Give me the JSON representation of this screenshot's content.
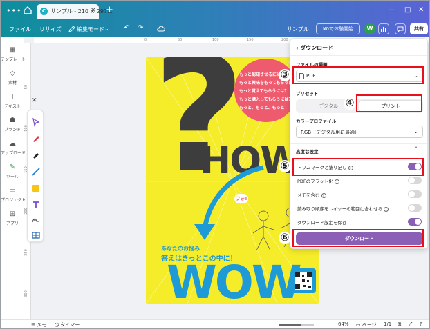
{
  "titlebar": {
    "dots": "•••",
    "tab_title": "サンプル - 210 × 297…",
    "tab_close": "×",
    "new_tab": "+",
    "win_min": "—",
    "win_max": "□",
    "win_close": "✕"
  },
  "toolbar": {
    "file": "ファイル",
    "resize": "リサイズ",
    "edit_mode": "編集モード",
    "doc_name": "サンプル",
    "trial": "¥0で体験開始",
    "avatar": "W",
    "share": "共有"
  },
  "sidebar": {
    "items": [
      {
        "label": "テンプレート",
        "icon": "▦"
      },
      {
        "label": "素材",
        "icon": "◇"
      },
      {
        "label": "テキスト",
        "icon": "T"
      },
      {
        "label": "ブランド",
        "icon": "☗"
      },
      {
        "label": "アップロード",
        "icon": "☁"
      },
      {
        "label": "ツール",
        "icon": "✎"
      },
      {
        "label": "プロジェクト",
        "icon": "▭"
      },
      {
        "label": "アプリ",
        "icon": "⊞"
      }
    ]
  },
  "rulers": {
    "top": [
      "0",
      "50",
      "100",
      "150",
      "200"
    ],
    "left": [
      "50",
      "100",
      "150",
      "200",
      "250",
      "300"
    ]
  },
  "poster": {
    "pink_lines": [
      "もっと認知させるには？",
      "もっと興味をもってもらうには？",
      "もっと覚えてもらうには？",
      "もっと購入してもらうには？",
      "もっと、もっと、もっと"
    ],
    "how": "HOW",
    "wow": "WOW",
    "wao": "ワォ!",
    "tagline1": "あなたのお悩み",
    "tagline2": "答えはきっとこの中に！"
  },
  "download": {
    "header": "ダウンロード",
    "file_type_label": "ファイルの種類",
    "file_type_value": "PDF",
    "preset_label": "プリセット",
    "preset_digital": "デジタル",
    "preset_print": "プリント",
    "color_profile_label": "カラープロファイル",
    "color_profile_value": "RGB（デジタル用に最適）",
    "advanced_label": "高度な設定",
    "options": [
      {
        "label": "トリムマークと塗り足し",
        "on": true
      },
      {
        "label": "PDFのフラット化",
        "on": false
      },
      {
        "label": "メモを含む",
        "on": false
      },
      {
        "label": "読み取り順序をレイヤーの範囲に合わせる",
        "on": false
      },
      {
        "label": "ダウンロード設定を保存",
        "on": true
      }
    ],
    "button": "ダウンロード"
  },
  "annotations": {
    "n3": "③",
    "n4": "④",
    "n5": "⑤",
    "n6": "⑥"
  },
  "statusbar": {
    "memo": "メモ",
    "timer": "タイマー",
    "zoom": "64%",
    "zoom_fraction": 0.64,
    "pages": "ページ",
    "page_num": "1/1"
  },
  "colors": {
    "accent_purple": "#8a5fb5",
    "annotation_red": "#e8101b",
    "poster_yellow": "#f5ec2a",
    "poster_blue": "#1e9ad7",
    "poster_pink": "#ef5b6e"
  }
}
